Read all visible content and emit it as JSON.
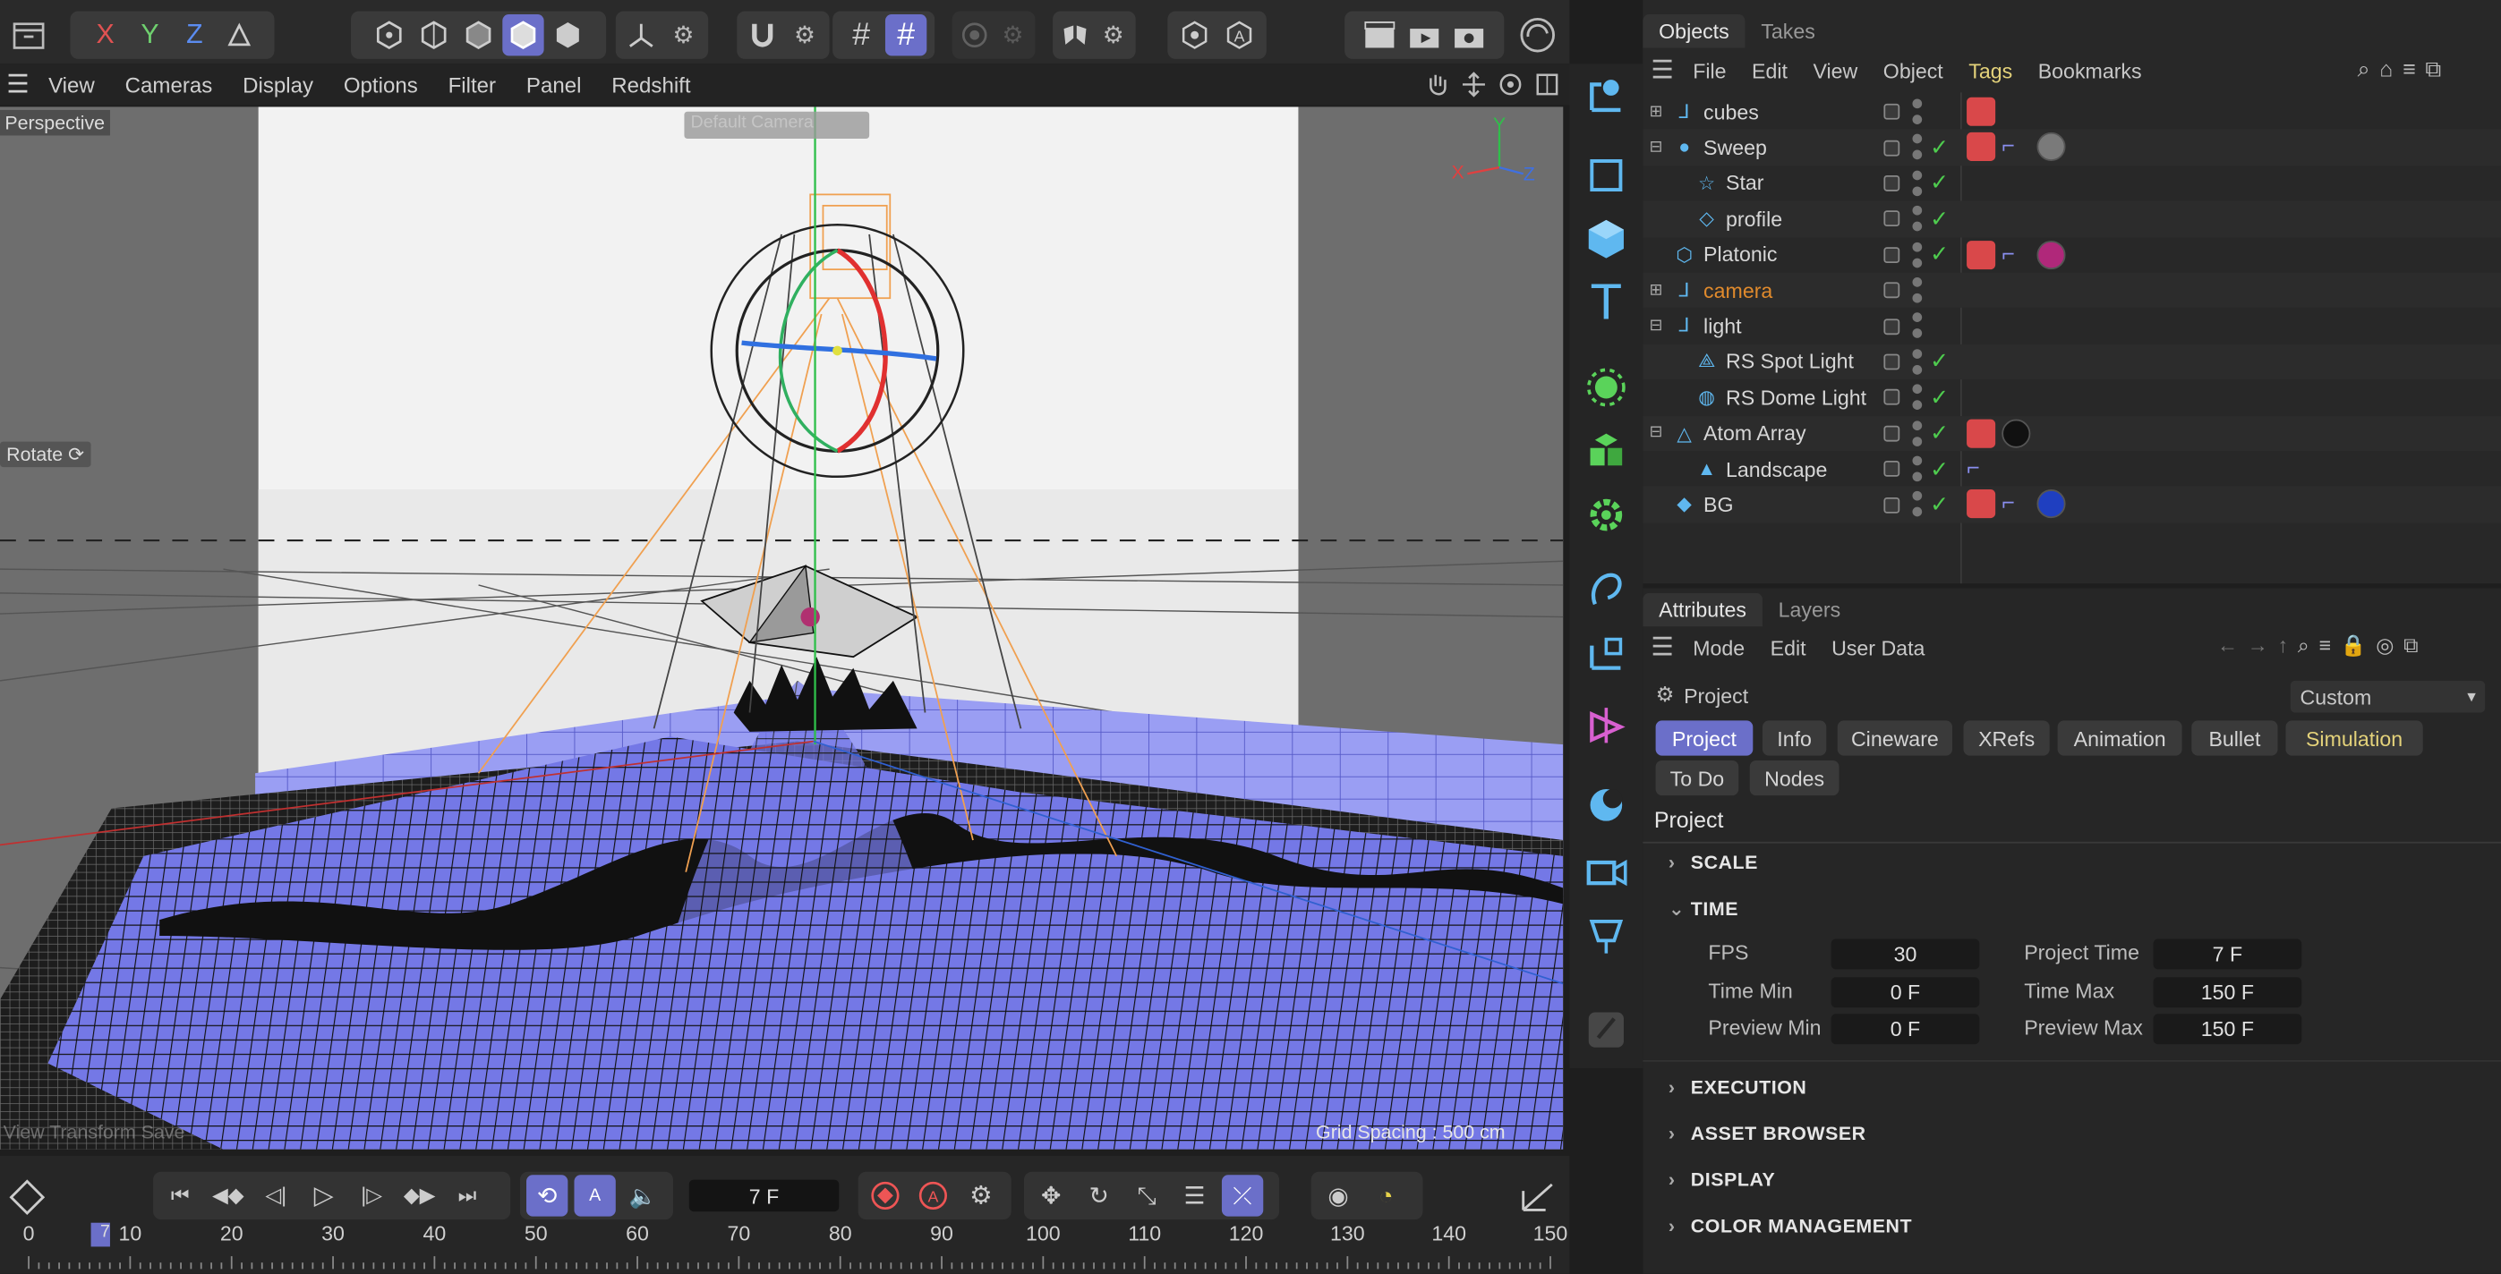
{
  "viewport_menu": [
    "View",
    "Cameras",
    "Display",
    "Options",
    "Filter",
    "Panel",
    "Redshift"
  ],
  "axis_labels": {
    "x": "X",
    "y": "Y",
    "z": "Z"
  },
  "viewport": {
    "name": "Perspective",
    "camera_badge": "Default Camera",
    "rotate": "Rotate",
    "hint": "View Transform Save",
    "grid": "Grid Spacing : 500 cm",
    "gizmo": {
      "x": "X",
      "y": "Y",
      "z": "Z"
    }
  },
  "timeline": {
    "frame": "7 F",
    "cursor": "7",
    "ticks": [
      "0",
      "10",
      "20",
      "30",
      "40",
      "50",
      "60",
      "70",
      "80",
      "90",
      "100",
      "110",
      "120",
      "130",
      "140",
      "150"
    ]
  },
  "objects_tabs": [
    "Objects",
    "Takes"
  ],
  "objects_menu": [
    "File",
    "Edit",
    "View",
    "Object",
    "Tags",
    "Bookmarks"
  ],
  "objects": [
    {
      "name": "cubes",
      "indent": 0,
      "exp": "+",
      "icon": "null-icon",
      "check": false,
      "tags": [
        "cube"
      ]
    },
    {
      "name": "Sweep",
      "indent": 0,
      "exp": "-",
      "icon": "sweep-icon",
      "check": true,
      "tags": [
        "cube",
        "flag",
        "texture-grey"
      ]
    },
    {
      "name": "Star",
      "indent": 1,
      "exp": "",
      "icon": "star-spline-icon",
      "check": true,
      "tags": []
    },
    {
      "name": "profile",
      "indent": 1,
      "exp": "",
      "icon": "diamond-spline-icon",
      "check": true,
      "tags": []
    },
    {
      "name": "Platonic",
      "indent": 0,
      "exp": "",
      "icon": "platonic-icon",
      "check": true,
      "tags": [
        "cube",
        "flag",
        "mat-magenta"
      ]
    },
    {
      "name": "camera",
      "indent": 0,
      "exp": "+",
      "icon": "null-icon",
      "check": false,
      "tags": [],
      "color": "#e08a2c"
    },
    {
      "name": "light",
      "indent": 0,
      "exp": "-",
      "icon": "null-icon",
      "check": false,
      "tags": []
    },
    {
      "name": "RS Spot Light",
      "indent": 1,
      "exp": "",
      "icon": "spotlight-icon",
      "check": true,
      "tags": []
    },
    {
      "name": "RS Dome Light",
      "indent": 1,
      "exp": "",
      "icon": "domelight-icon",
      "check": true,
      "tags": []
    },
    {
      "name": "Atom Array",
      "indent": 0,
      "exp": "-",
      "icon": "atom-icon",
      "check": true,
      "tags": [
        "cube",
        "mat-black"
      ]
    },
    {
      "name": "Landscape",
      "indent": 1,
      "exp": "",
      "icon": "landscape-icon",
      "check": true,
      "tags": [
        "flag"
      ]
    },
    {
      "name": "BG",
      "indent": 0,
      "exp": "",
      "icon": "plane-icon",
      "check": true,
      "tags": [
        "cube",
        "flag",
        "mat-blue"
      ]
    }
  ],
  "attributes_tabs": [
    "Attributes",
    "Layers"
  ],
  "attributes_menu": [
    "Mode",
    "Edit",
    "User Data"
  ],
  "attributes": {
    "title": "Project",
    "preset": "Custom",
    "pills": [
      "Project",
      "Info",
      "Cineware",
      "XRefs",
      "Animation",
      "Bullet",
      "Simulation",
      "To Do",
      "Nodes"
    ],
    "section_title": "Project",
    "sections": [
      "SCALE",
      "TIME",
      "EXECUTION",
      "ASSET BROWSER",
      "DISPLAY",
      "COLOR MANAGEMENT"
    ],
    "time": {
      "fps_label": "FPS",
      "fps": "30",
      "project_time_label": "Project Time",
      "project_time": "7 F",
      "time_min_label": "Time Min",
      "time_min": "0 F",
      "time_max_label": "Time Max",
      "time_max": "150 F",
      "preview_min_label": "Preview Min",
      "preview_min": "0 F",
      "preview_max_label": "Preview Max",
      "preview_max": "150 F"
    }
  },
  "colors": {
    "accent": "#6b6fc9",
    "check": "#4ecb4e",
    "tag_red": "#d9484a",
    "plane": "#8c8ff0",
    "simulation": "#e4d27a"
  }
}
